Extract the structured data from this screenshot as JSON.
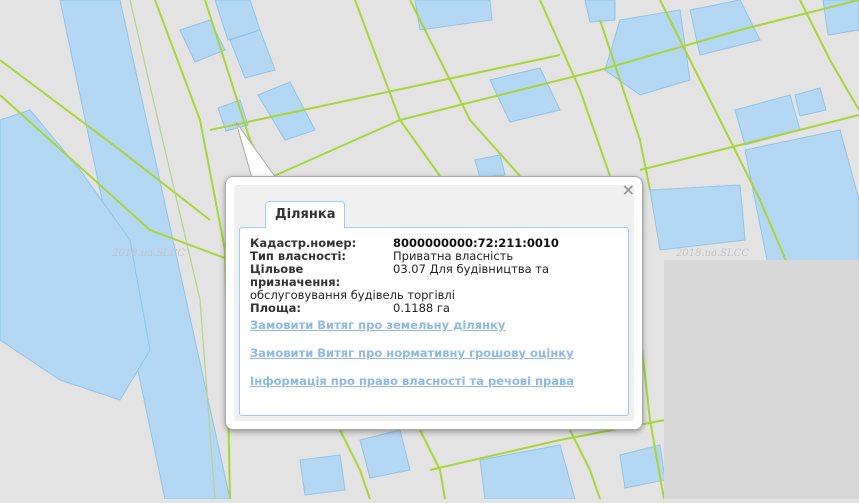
{
  "map": {
    "watermark": "2018.ua.SLCC",
    "colors": {
      "background": "#e3e3e3",
      "building": "#b4d8f3",
      "parcel_line": "#a9d43a"
    }
  },
  "popup": {
    "tab_label": "Ділянка",
    "close_icon": "×",
    "fields": [
      {
        "label": "Кадастр.номер:",
        "value": "8000000000:72:211:0010"
      },
      {
        "label": "Тип власності:",
        "value": "Приватна власність"
      },
      {
        "label": "Цільове призначення:",
        "value": "03.07 Для будівництва та",
        "value_cont": "обслуговування будівель торгівлі"
      },
      {
        "label": "Площа:",
        "value": "0.1188 га"
      }
    ],
    "links": [
      "Замовити Витяг про земельну ділянку",
      "Замовити Витяг про нормативну грошову оцінку",
      "Інформація про право власності та речові права"
    ]
  }
}
